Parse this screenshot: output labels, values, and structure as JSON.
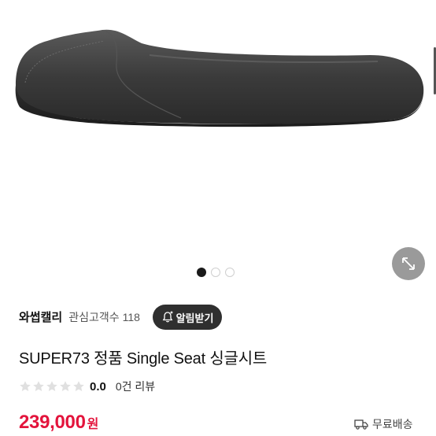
{
  "gallery": {
    "image_alt": "seat",
    "dots": [
      "active",
      "inactive",
      "inactive"
    ],
    "expand_icon": "expand-arrows-icon"
  },
  "seller": {
    "name": "와썹캘리",
    "fav_label": "관심고객수",
    "fav_count": "118"
  },
  "alert_button": {
    "label": "알림받기",
    "icon": "bell-plus-icon"
  },
  "product": {
    "title": "SUPER73 정품 Single Seat 싱글시트"
  },
  "rating": {
    "stars_filled": 0,
    "stars_total": 5,
    "value": "0.0",
    "review_count": "0건 리뷰"
  },
  "price": {
    "amount": "239,000",
    "currency": "원"
  },
  "shipping": {
    "icon": "truck-icon",
    "label": "무료배송"
  },
  "colors": {
    "price": "#e3143c",
    "alert_bg": "#2f2f2f",
    "expand_bg": "#9a9a9a"
  }
}
